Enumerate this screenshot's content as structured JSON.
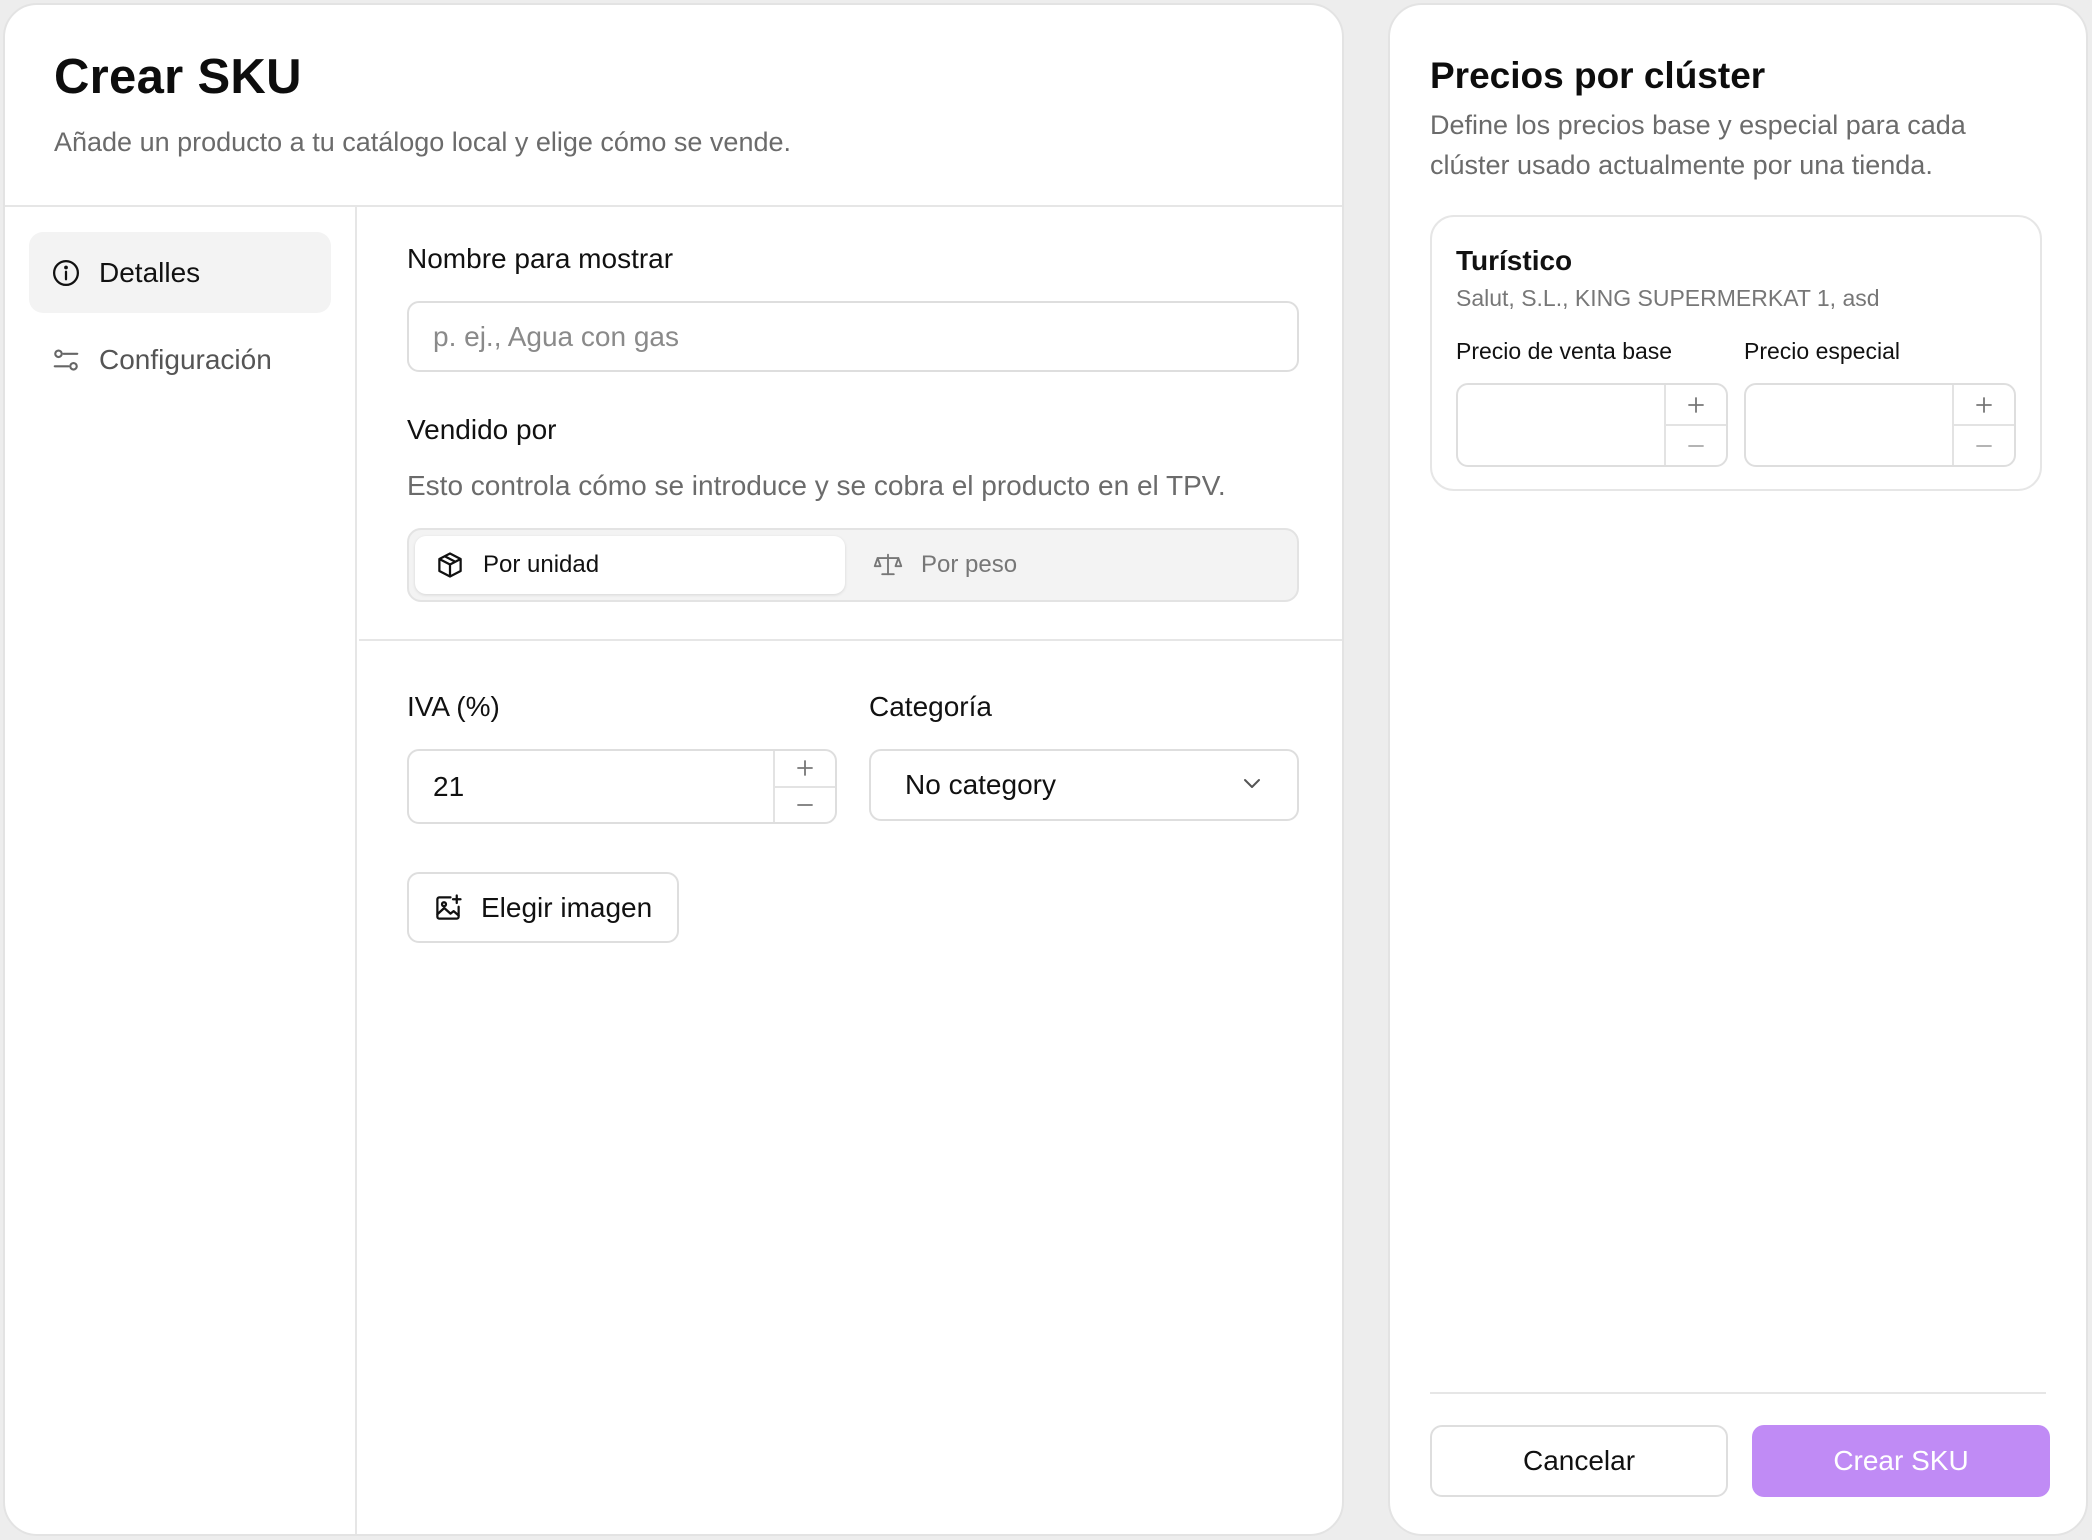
{
  "left": {
    "title": "Crear SKU",
    "subtitle": "Añade un producto a tu catálogo local y elige cómo se vende.",
    "nav": [
      {
        "label": "Detalles",
        "icon": "info-circle-icon",
        "active": true
      },
      {
        "label": "Configuración",
        "icon": "sliders-icon",
        "active": false
      }
    ],
    "form": {
      "display_name_label": "Nombre para mostrar",
      "display_name_placeholder": "p. ej., Agua con gas",
      "display_name_value": "",
      "sold_by_label": "Vendido por",
      "sold_by_help": "Esto controla cómo se introduce y se cobra el producto en el TPV.",
      "sold_by_options": [
        {
          "label": "Por unidad",
          "icon": "box-icon",
          "selected": true
        },
        {
          "label": "Por peso",
          "icon": "scale-icon",
          "selected": false
        }
      ],
      "vat_label": "IVA (%)",
      "vat_value": "21",
      "category_label": "Categoría",
      "category_value": "No category",
      "image_button_label": "Elegir imagen"
    }
  },
  "right": {
    "title": "Precios por clúster",
    "description": "Define los precios base y especial para cada clúster usado actualmente por una tienda.",
    "clusters": [
      {
        "name": "Turístico",
        "stores": "Salut, S.L., KING SUPERMERKAT 1, asd",
        "base_price_label": "Precio de venta base",
        "base_price_value": "",
        "special_price_label": "Precio especial",
        "special_price_value": ""
      }
    ],
    "cancel_label": "Cancelar",
    "create_label": "Crear SKU"
  },
  "colors": {
    "accent_disabled": "#c08bf5",
    "border": "#dedede",
    "muted_text": "#6b6b6b"
  }
}
